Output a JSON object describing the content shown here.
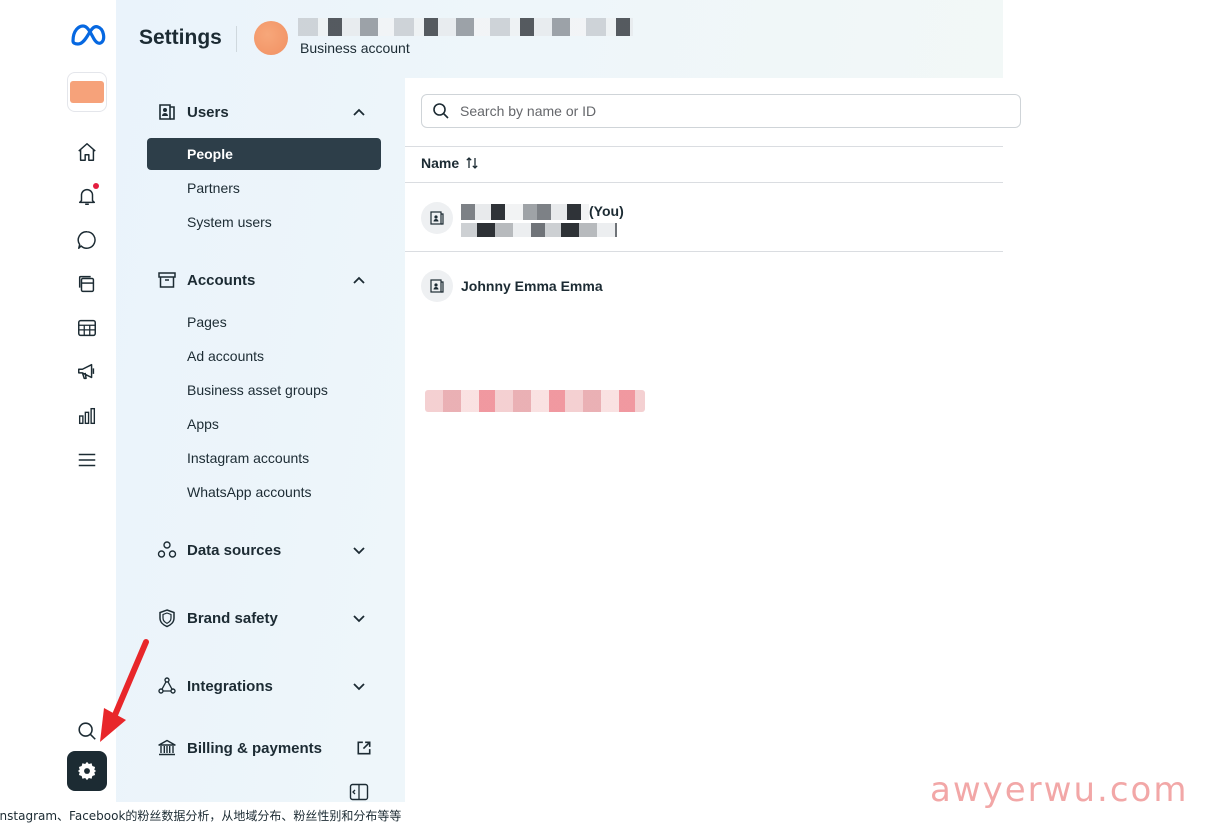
{
  "header": {
    "title": "Settings",
    "account_type": "Business account"
  },
  "sidebar": {
    "sections": [
      {
        "label": "Users",
        "icon": "users-icon",
        "expanded": true,
        "items": [
          {
            "label": "People",
            "active": true
          },
          {
            "label": "Partners"
          },
          {
            "label": "System users"
          }
        ]
      },
      {
        "label": "Accounts",
        "icon": "archive-box-icon",
        "expanded": true,
        "items": [
          {
            "label": "Pages"
          },
          {
            "label": "Ad accounts"
          },
          {
            "label": "Business asset groups"
          },
          {
            "label": "Apps"
          },
          {
            "label": "Instagram accounts"
          },
          {
            "label": "WhatsApp accounts"
          }
        ]
      },
      {
        "label": "Data sources",
        "icon": "data-sources-icon",
        "expanded": false
      },
      {
        "label": "Brand safety",
        "icon": "shield-icon",
        "expanded": false
      },
      {
        "label": "Integrations",
        "icon": "integrations-icon",
        "expanded": false
      },
      {
        "label": "Billing & payments",
        "icon": "bank-icon",
        "external": true
      }
    ]
  },
  "main": {
    "search": {
      "placeholder": "Search by name or ID",
      "value": ""
    },
    "table": {
      "column_name": "Name",
      "rows": [
        {
          "name_suffix": "(You)"
        },
        {
          "name": "Johnny Emma Emma"
        }
      ]
    }
  },
  "watermark": "awyerwu.com",
  "caption": "Instagram、Facebook的粉丝数据分析，从地域分布、粉丝性别和分布等等",
  "colors": {
    "accent_dark": "#1c2b33",
    "active_nav": "#2d3e49",
    "notification": "#e41e3f",
    "meta_blue": "#0668e1",
    "annotation_arrow": "#e8262a"
  }
}
